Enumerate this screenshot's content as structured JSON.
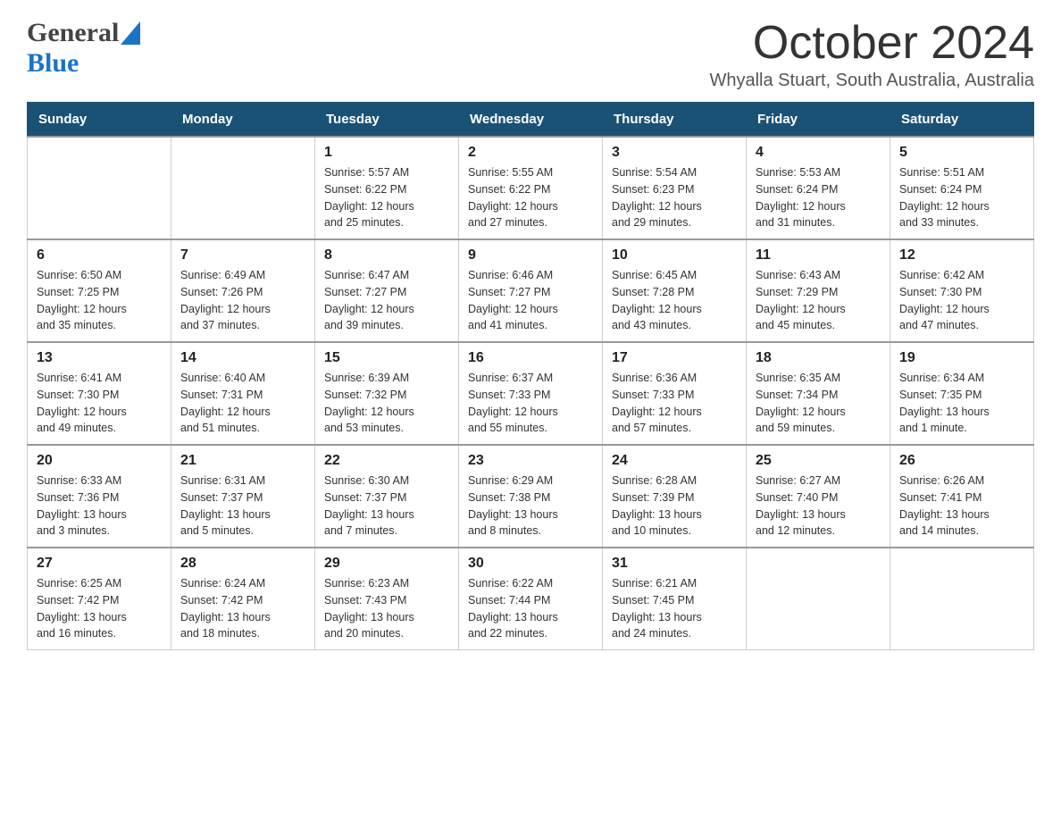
{
  "header": {
    "logo_general": "General",
    "logo_blue": "Blue",
    "title": "October 2024",
    "subtitle": "Whyalla Stuart, South Australia, Australia"
  },
  "weekdays": [
    "Sunday",
    "Monday",
    "Tuesday",
    "Wednesday",
    "Thursday",
    "Friday",
    "Saturday"
  ],
  "weeks": [
    {
      "days": [
        {
          "num": "",
          "info": ""
        },
        {
          "num": "",
          "info": ""
        },
        {
          "num": "1",
          "info": "Sunrise: 5:57 AM\nSunset: 6:22 PM\nDaylight: 12 hours\nand 25 minutes."
        },
        {
          "num": "2",
          "info": "Sunrise: 5:55 AM\nSunset: 6:22 PM\nDaylight: 12 hours\nand 27 minutes."
        },
        {
          "num": "3",
          "info": "Sunrise: 5:54 AM\nSunset: 6:23 PM\nDaylight: 12 hours\nand 29 minutes."
        },
        {
          "num": "4",
          "info": "Sunrise: 5:53 AM\nSunset: 6:24 PM\nDaylight: 12 hours\nand 31 minutes."
        },
        {
          "num": "5",
          "info": "Sunrise: 5:51 AM\nSunset: 6:24 PM\nDaylight: 12 hours\nand 33 minutes."
        }
      ]
    },
    {
      "days": [
        {
          "num": "6",
          "info": "Sunrise: 6:50 AM\nSunset: 7:25 PM\nDaylight: 12 hours\nand 35 minutes."
        },
        {
          "num": "7",
          "info": "Sunrise: 6:49 AM\nSunset: 7:26 PM\nDaylight: 12 hours\nand 37 minutes."
        },
        {
          "num": "8",
          "info": "Sunrise: 6:47 AM\nSunset: 7:27 PM\nDaylight: 12 hours\nand 39 minutes."
        },
        {
          "num": "9",
          "info": "Sunrise: 6:46 AM\nSunset: 7:27 PM\nDaylight: 12 hours\nand 41 minutes."
        },
        {
          "num": "10",
          "info": "Sunrise: 6:45 AM\nSunset: 7:28 PM\nDaylight: 12 hours\nand 43 minutes."
        },
        {
          "num": "11",
          "info": "Sunrise: 6:43 AM\nSunset: 7:29 PM\nDaylight: 12 hours\nand 45 minutes."
        },
        {
          "num": "12",
          "info": "Sunrise: 6:42 AM\nSunset: 7:30 PM\nDaylight: 12 hours\nand 47 minutes."
        }
      ]
    },
    {
      "days": [
        {
          "num": "13",
          "info": "Sunrise: 6:41 AM\nSunset: 7:30 PM\nDaylight: 12 hours\nand 49 minutes."
        },
        {
          "num": "14",
          "info": "Sunrise: 6:40 AM\nSunset: 7:31 PM\nDaylight: 12 hours\nand 51 minutes."
        },
        {
          "num": "15",
          "info": "Sunrise: 6:39 AM\nSunset: 7:32 PM\nDaylight: 12 hours\nand 53 minutes."
        },
        {
          "num": "16",
          "info": "Sunrise: 6:37 AM\nSunset: 7:33 PM\nDaylight: 12 hours\nand 55 minutes."
        },
        {
          "num": "17",
          "info": "Sunrise: 6:36 AM\nSunset: 7:33 PM\nDaylight: 12 hours\nand 57 minutes."
        },
        {
          "num": "18",
          "info": "Sunrise: 6:35 AM\nSunset: 7:34 PM\nDaylight: 12 hours\nand 59 minutes."
        },
        {
          "num": "19",
          "info": "Sunrise: 6:34 AM\nSunset: 7:35 PM\nDaylight: 13 hours\nand 1 minute."
        }
      ]
    },
    {
      "days": [
        {
          "num": "20",
          "info": "Sunrise: 6:33 AM\nSunset: 7:36 PM\nDaylight: 13 hours\nand 3 minutes."
        },
        {
          "num": "21",
          "info": "Sunrise: 6:31 AM\nSunset: 7:37 PM\nDaylight: 13 hours\nand 5 minutes."
        },
        {
          "num": "22",
          "info": "Sunrise: 6:30 AM\nSunset: 7:37 PM\nDaylight: 13 hours\nand 7 minutes."
        },
        {
          "num": "23",
          "info": "Sunrise: 6:29 AM\nSunset: 7:38 PM\nDaylight: 13 hours\nand 8 minutes."
        },
        {
          "num": "24",
          "info": "Sunrise: 6:28 AM\nSunset: 7:39 PM\nDaylight: 13 hours\nand 10 minutes."
        },
        {
          "num": "25",
          "info": "Sunrise: 6:27 AM\nSunset: 7:40 PM\nDaylight: 13 hours\nand 12 minutes."
        },
        {
          "num": "26",
          "info": "Sunrise: 6:26 AM\nSunset: 7:41 PM\nDaylight: 13 hours\nand 14 minutes."
        }
      ]
    },
    {
      "days": [
        {
          "num": "27",
          "info": "Sunrise: 6:25 AM\nSunset: 7:42 PM\nDaylight: 13 hours\nand 16 minutes."
        },
        {
          "num": "28",
          "info": "Sunrise: 6:24 AM\nSunset: 7:42 PM\nDaylight: 13 hours\nand 18 minutes."
        },
        {
          "num": "29",
          "info": "Sunrise: 6:23 AM\nSunset: 7:43 PM\nDaylight: 13 hours\nand 20 minutes."
        },
        {
          "num": "30",
          "info": "Sunrise: 6:22 AM\nSunset: 7:44 PM\nDaylight: 13 hours\nand 22 minutes."
        },
        {
          "num": "31",
          "info": "Sunrise: 6:21 AM\nSunset: 7:45 PM\nDaylight: 13 hours\nand 24 minutes."
        },
        {
          "num": "",
          "info": ""
        },
        {
          "num": "",
          "info": ""
        }
      ]
    }
  ]
}
